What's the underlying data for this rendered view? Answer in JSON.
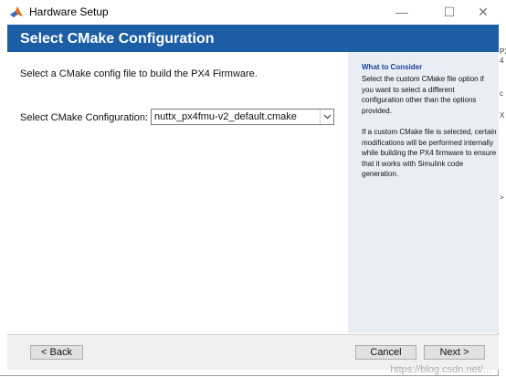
{
  "window": {
    "title": "Hardware Setup",
    "minimize": "—",
    "maximize": "☐",
    "close": "✕"
  },
  "header": {
    "title": "Select CMake Configuration"
  },
  "main": {
    "instruction": "Select a CMake config file to build the PX4 Firmware.",
    "config_label": "Select CMake Configuration:",
    "config_value": "nuttx_px4fmu-v2_default.cmake"
  },
  "side": {
    "title": "What to Consider",
    "p1": "Select the custom CMake file option if you want to select a different configuration other than the options provided.",
    "p2": "If a custom CMake file is selected, certain modifications will be performed internally while building the PX4 firmware to ensure that it works with Simulink code generation."
  },
  "footer": {
    "back": "< Back",
    "cancel": "Cancel",
    "next": "Next >"
  },
  "edge": {
    "c1": "PX",
    "c2": "4",
    "c3": "c",
    "c4": "X",
    "c5": ">"
  },
  "watermark": "https://blog.csdn.net/...",
  "colors": {
    "header": "#1b5ea6",
    "side_bg": "#e9edf5",
    "side_title": "#1b3fa0"
  }
}
